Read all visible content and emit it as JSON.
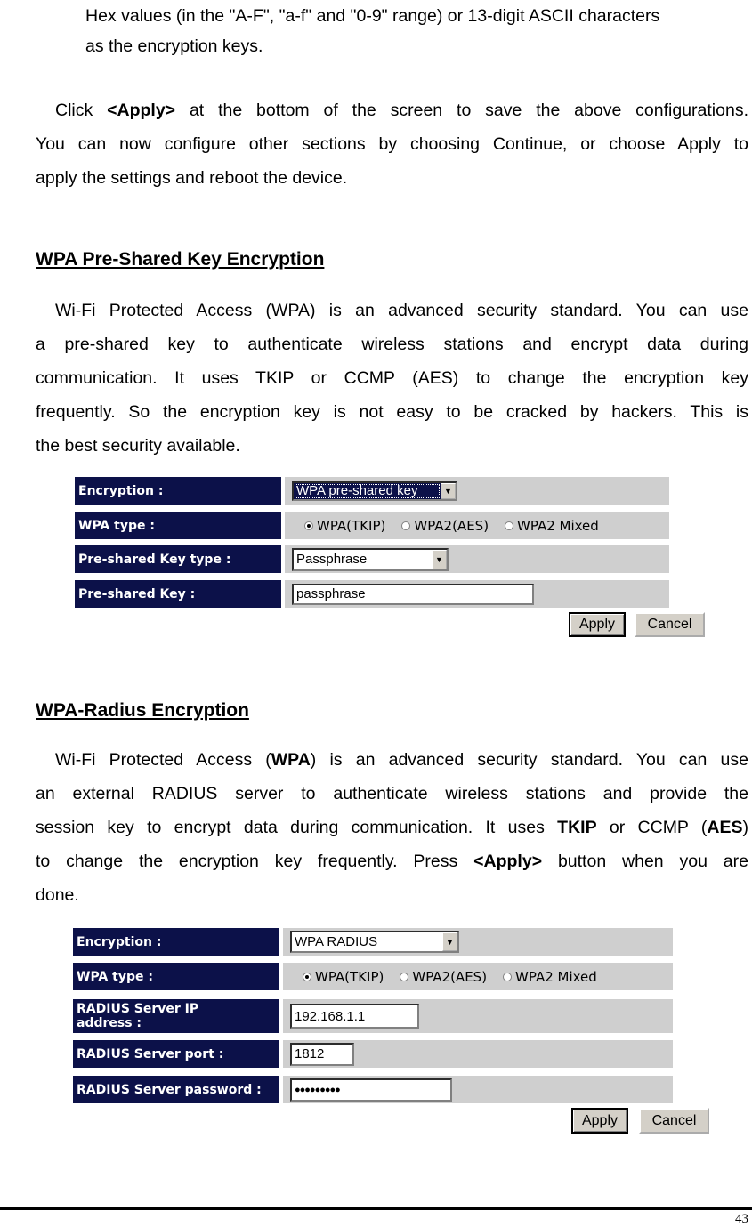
{
  "intro": {
    "line1": "Hex values (in the \"A-F\", \"a-f\" and \"0-9\" range) or 13-digit ASCII characters",
    "line2": "as the encryption keys."
  },
  "apply_note": {
    "pre": "Click ",
    "bold": "<Apply>",
    "post": " at the bottom of the screen to save the above configurations.",
    "line2": "You can now configure other sections by choosing Continue, or choose Apply to",
    "line3": "apply the settings and reboot the device."
  },
  "psk_section": {
    "heading": "WPA Pre-Shared Key Encryption",
    "lines": [
      "Wi-Fi Protected Access (WPA) is an advanced security standard. You can use",
      "a pre-shared key to authenticate wireless stations and encrypt data during",
      "communication. It uses TKIP or CCMP (AES) to change the encryption key",
      "frequently. So the encryption key is not easy to be cracked by hackers. This is",
      "the best security available."
    ],
    "form": {
      "encryption_label": "Encryption :",
      "encryption_value": "WPA pre-shared key",
      "wpa_type_label": "WPA type :",
      "wpa_options": [
        {
          "label": "WPA(TKIP)",
          "selected": true
        },
        {
          "label": "WPA2(AES)",
          "selected": false
        },
        {
          "label": "WPA2 Mixed",
          "selected": false
        }
      ],
      "key_type_label": "Pre-shared Key type :",
      "key_type_value": "Passphrase",
      "key_label": "Pre-shared Key :",
      "key_value": "passphrase",
      "apply_label": "Apply",
      "cancel_label": "Cancel"
    }
  },
  "radius_section": {
    "heading": "WPA-Radius Encryption",
    "line1_pre": "Wi-Fi Protected Access (",
    "line1_bold": "WPA",
    "line1_post": ") is an advanced security standard. You can use",
    "line2": "an external RADIUS server to authenticate wireless stations and provide the",
    "line3_pre": "session key to encrypt data during communication. It uses ",
    "line3_bold1": "TKIP",
    "line3_mid": " or CCMP (",
    "line3_bold2": "AES",
    "line3_post": ")",
    "line4_pre": "to change the encryption key frequently. Press ",
    "line4_bold": "<Apply>",
    "line4_post": " button when you are",
    "line5": "done.",
    "form": {
      "encryption_label": "Encryption :",
      "encryption_value": "WPA RADIUS",
      "wpa_type_label": "WPA type :",
      "wpa_options": [
        {
          "label": "WPA(TKIP)",
          "selected": true
        },
        {
          "label": "WPA2(AES)",
          "selected": false
        },
        {
          "label": "WPA2 Mixed",
          "selected": false
        }
      ],
      "ip_label_line1": "RADIUS Server IP",
      "ip_label_line2": "address :",
      "ip_value": "192.168.1.1",
      "port_label": "RADIUS Server port :",
      "port_value": "1812",
      "password_label": "RADIUS Server password :",
      "password_value": "●●●●●●●●●",
      "apply_label": "Apply",
      "cancel_label": "Cancel"
    }
  },
  "footer": {
    "page_number": "43"
  }
}
